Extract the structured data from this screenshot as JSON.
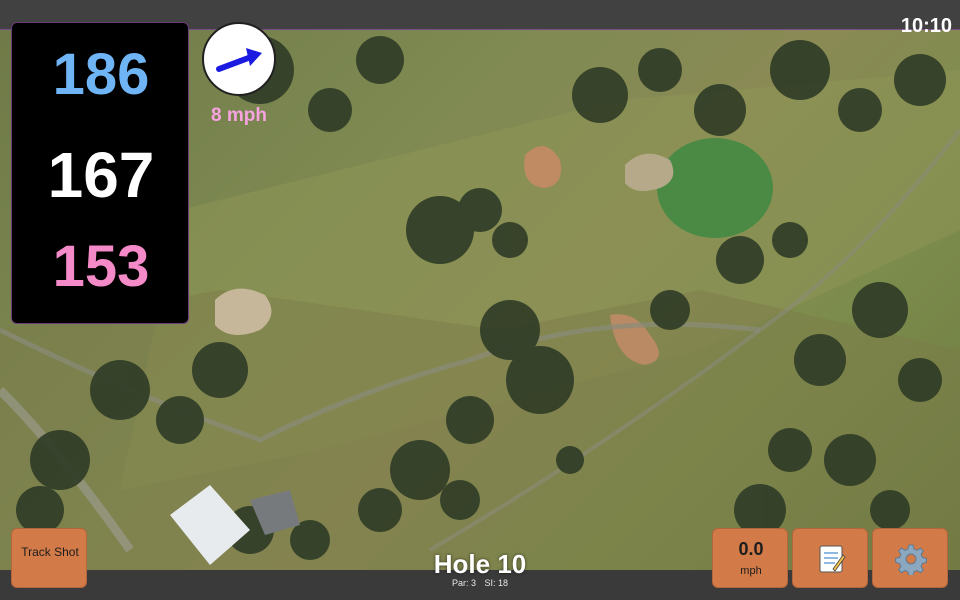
{
  "status": {
    "time": "10:10"
  },
  "distances": {
    "back": "186",
    "middle": "167",
    "front": "153"
  },
  "wind": {
    "speed_label": "8 mph",
    "direction_icon": "arrow-up-right-icon"
  },
  "hole": {
    "title": "Hole 10",
    "par": "Par: 3",
    "stroke_index": "SI: 18"
  },
  "buttons": {
    "track_shot": "Track Shot",
    "wind_value": "0.0",
    "wind_unit": "mph",
    "notes_icon": "notepad-icon",
    "settings_icon": "gear-icon"
  },
  "colors": {
    "back": "#6fb4f5",
    "middle": "#ffffff",
    "front": "#f58ac8",
    "wind_text": "#f6a3e0",
    "button": "#d27a48",
    "arrow": "#1a1ae0"
  }
}
